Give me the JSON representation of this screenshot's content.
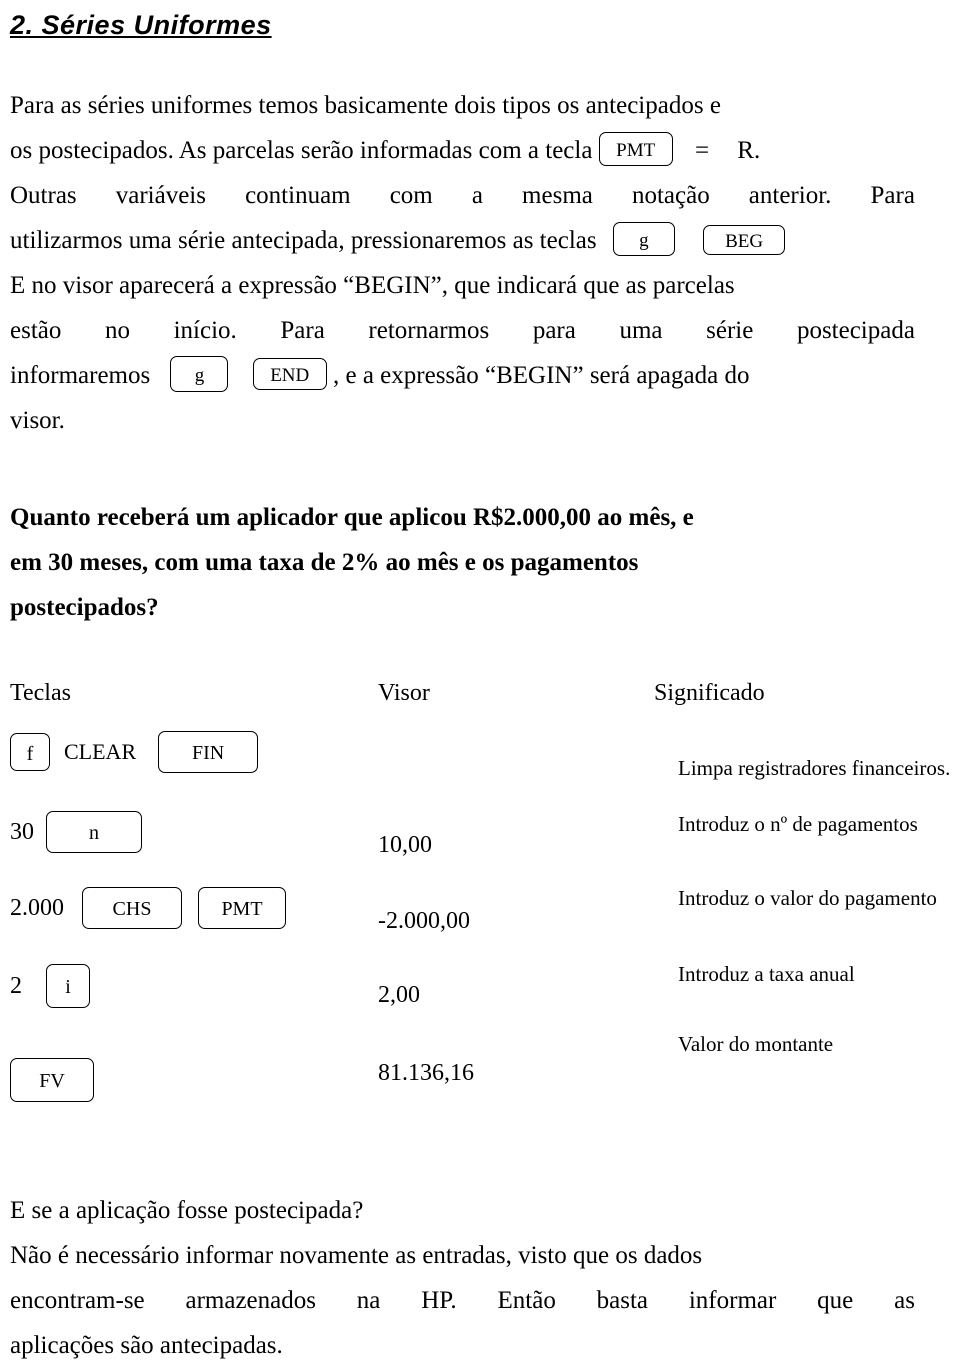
{
  "document": {
    "heading": "2. Séries Uniformes",
    "intro": {
      "l1a": "Para as séries uniformes temos basicamente dois tipos os antecipados e",
      "l2a": "os postecipados. As parcelas serão informadas com a tecla",
      "key_pmt": "PMT",
      "l2b": "=",
      "l2c": "R.",
      "l3a": "Outras",
      "l3b": "variáveis",
      "l3c": "continuam",
      "l3d": "com",
      "l3e": "a",
      "l3f": "mesma",
      "l3g": "notação",
      "l3h": "anterior.",
      "l3i": "Para",
      "l4a": "utilizarmos uma série antecipada, pressionaremos as teclas",
      "key_g1": "g",
      "key_beg": "BEG",
      "l5a": "E no visor aparecerá a expressão “BEGIN”, que indicará que as parcelas",
      "l6a": "estão",
      "l6b": "no",
      "l6c": "início.",
      "l6d": "Para",
      "l6e": "retornarmos",
      "l6f": "para",
      "l6g": "uma",
      "l6h": "série",
      "l6i": "postecipada",
      "l7a": "informaremos",
      "key_g2": "g",
      "key_end": "END",
      "l7b": ", e a expressão “BEGIN” será apagada do",
      "l8a": "visor."
    },
    "question": {
      "l1": "Quanto receberá um aplicador que aplicou R$2.000,00 ao mês, e",
      "l2": "em 30 meses, com uma taxa de 2% ao mês e os pagamentos",
      "l3": "postecipados?"
    },
    "table": {
      "headers": {
        "keys": "Teclas",
        "display": "Visor",
        "meaning": "Significado"
      },
      "rows": [
        {
          "keys": [
            {
              "type": "key",
              "label": "f",
              "style": "key-f"
            },
            {
              "type": "text",
              "label": "CLEAR"
            },
            {
              "type": "key",
              "label": "FIN",
              "style": "key-fin"
            }
          ],
          "display": "",
          "meaning": "Limpa registradores financeiros."
        },
        {
          "keys": [
            {
              "type": "num",
              "label": "30"
            },
            {
              "type": "key",
              "label": "n",
              "style": "key-n"
            }
          ],
          "display": "10,00",
          "meaning": "Introduz o nº de pagamentos"
        },
        {
          "keys": [
            {
              "type": "num",
              "label": "2.000"
            },
            {
              "type": "key",
              "label": "CHS",
              "style": "key-chs"
            },
            {
              "type": "key",
              "label": "PMT",
              "style": "key-pmt"
            }
          ],
          "display": "-2.000,00",
          "meaning": "Introduz o valor do pagamento"
        },
        {
          "keys": [
            {
              "type": "num",
              "label": "2"
            },
            {
              "type": "key",
              "label": "i",
              "style": "key-i"
            }
          ],
          "display": "2,00",
          "meaning": "Introduz a taxa anual"
        },
        {
          "keys": [
            {
              "type": "key",
              "label": "FV",
              "style": "key-fv"
            }
          ],
          "display": "81.136,16",
          "meaning": "Valor do montante"
        }
      ]
    },
    "closing": {
      "l1": "E se a aplicação fosse postecipada?",
      "l2": "Não é necessário informar novamente as entradas, visto que os dados",
      "l3a": "encontram-se",
      "l3b": "armazenados",
      "l3c": "na",
      "l3d": "HP.",
      "l3e": "Então",
      "l3f": "basta",
      "l3g": "informar",
      "l3h": "que",
      "l3i": "as",
      "l4": "aplicações são antecipadas."
    }
  }
}
